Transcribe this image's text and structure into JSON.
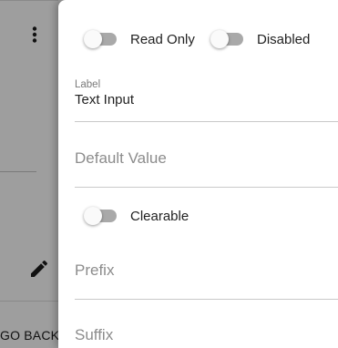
{
  "background": {
    "go_back_label": "GO BACK",
    "icons": [
      "kebab-menu-icon",
      "pencil-icon"
    ]
  },
  "drawer": {
    "toggles": {
      "read_only": {
        "label": "Read Only",
        "checked": false
      },
      "disabled": {
        "label": "Disabled",
        "checked": false
      },
      "clearable": {
        "label": "Clearable",
        "checked": false
      }
    },
    "label_field": {
      "label": "Label",
      "value": "Text Input"
    },
    "default_value_field": {
      "placeholder": "Default Value"
    },
    "prefix_field": {
      "placeholder": "Prefix"
    },
    "suffix_field": {
      "placeholder": "Suffix"
    }
  },
  "colors": {
    "overlay": "#9e9e9e",
    "panel": "#ffffff",
    "switch_track_off": "#a9a9a9",
    "switch_thumb": "#fafafa"
  }
}
